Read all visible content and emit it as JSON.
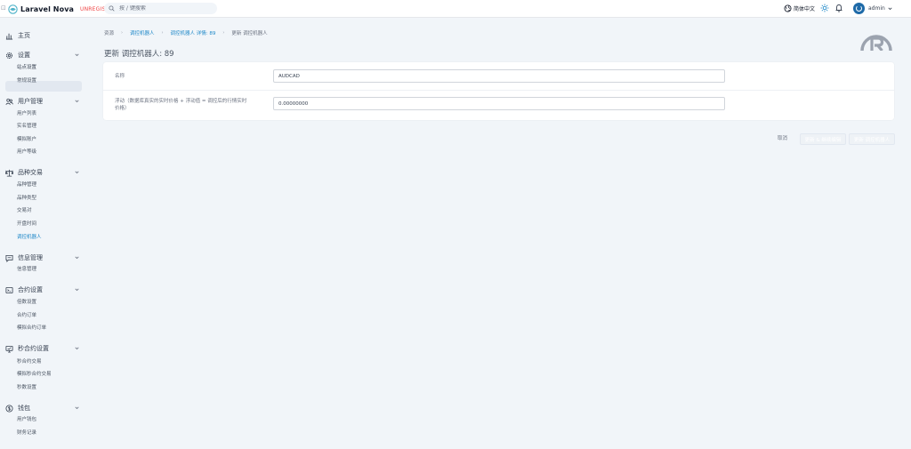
{
  "topbar": {
    "bracket": "⊡",
    "brand_name": "Laravel Nova",
    "brand_badge": "UNREGISTERED",
    "search_placeholder": "按 / 键搜索",
    "language": "简体中文",
    "user_name": "admin"
  },
  "sidebar": {
    "groups": [
      {
        "label": "主页",
        "icon": "chart-bar-icon",
        "items": []
      },
      {
        "label": "设置",
        "icon": "gear-icon",
        "items": [
          "站点设置",
          "常规设置"
        ]
      },
      {
        "label": "用户管理",
        "icon": "users-icon",
        "items": [
          "用户列表",
          "实名管理",
          "模拟账户",
          "用户等级"
        ]
      },
      {
        "label": "品种交易",
        "icon": "scale-icon",
        "items": [
          "品种管理",
          "品种类型",
          "交易对",
          "开盘时间",
          "调控机器人"
        ]
      },
      {
        "label": "信息管理",
        "icon": "chat-icon",
        "items": [
          "信息管理"
        ]
      },
      {
        "label": "合约设置",
        "icon": "terminal-icon",
        "items": [
          "倍数设置",
          "合约订单",
          "模拟合约订单"
        ]
      },
      {
        "label": "秒合约设置",
        "icon": "screen-icon",
        "items": [
          "秒合约交易",
          "模拟秒合约交易",
          "秒数设置"
        ]
      },
      {
        "label": "钱包",
        "icon": "dollar-icon",
        "items": [
          "用户钱包",
          "财务记录"
        ]
      }
    ]
  },
  "breadcrumb": {
    "items": [
      "资源",
      "调控机器人",
      "调控机器人 详情: 89",
      "更新 调控机器人"
    ]
  },
  "page": {
    "title": "更新 调控机器人: 89"
  },
  "form": {
    "name_label": "名称",
    "name_value": "AUDCAD",
    "float_label_line1": "浮动（数据库真实的实时价格 + 浮动值 = 调控后的行情实时",
    "float_label_line2": "价格）",
    "float_value": "0.00000000"
  },
  "actions": {
    "cancel": "取消",
    "update_continue": "更新 & 继续编辑",
    "update": "更新 调控机器人"
  },
  "colors": {
    "accent": "#1e88c8",
    "badge": "#ef4444",
    "background": "#f1f5f9"
  }
}
